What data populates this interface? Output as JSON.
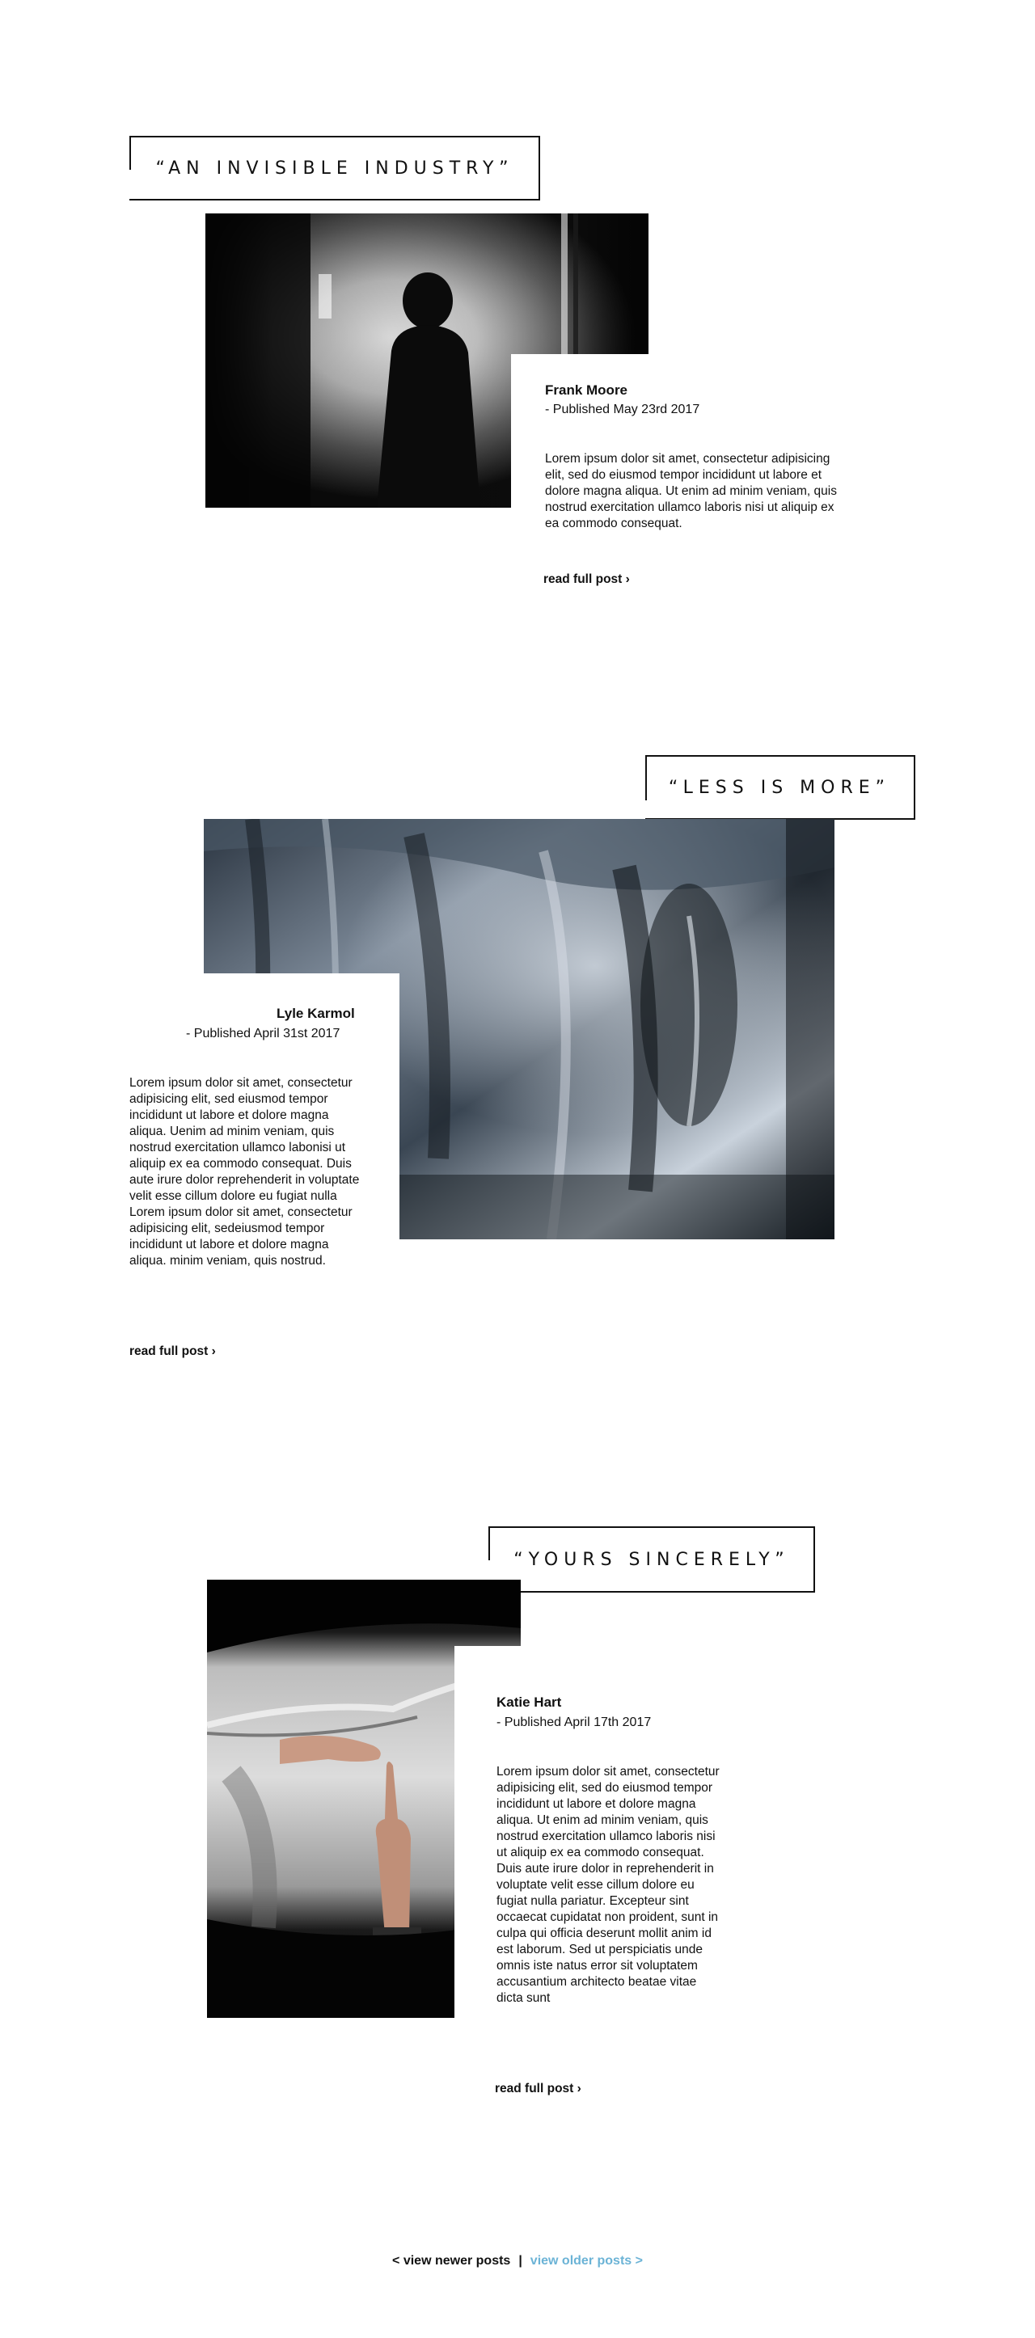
{
  "posts": [
    {
      "title": "“AN INVISIBLE INDUSTRY”",
      "author": "Frank Moore",
      "published": "- Published May 23rd 2017",
      "excerpt": "Lorem ipsum dolor sit amet, consectetur adipisicing elit, sed do eiusmod tempor incididunt ut labore et dolore magna aliqua. Ut enim ad minim veniam, quis nostrud exercitation ullamco laboris nisi ut aliquip ex ea commodo consequat.",
      "read_more": "read full post ›",
      "image": "figure-in-fog-photo"
    },
    {
      "title": "“LESS IS MORE”",
      "author": "Lyle Karmol",
      "published": "- Published April 31st 2017",
      "excerpt": "Lorem ipsum dolor sit amet, consectetur adipisicing elit, sed eiusmod tempor incididunt ut labore et dolore magna aliqua. Uenim ad minim veniam, quis nostrud exercitation ullamco labonisi ut aliquip ex ea commodo consequat. Duis aute irure dolor reprehenderit in voluptate velit esse cillum dolore eu fugiat nulla Lorem ipsum dolor sit amet, consectetur adipisicing elit, sedeiusmod tempor incididunt ut labore et dolore magna aliqua. minim veniam, quis nostrud.",
      "read_more": "read full post ›",
      "image": "metal-sculpture-photo"
    },
    {
      "title": "“YOURS SINCERELY”",
      "author": "Katie Hart",
      "published": "- Published April 17th 2017",
      "excerpt": "Lorem ipsum dolor sit amet, consectetur adipisicing elit, sed do eiusmod tempor incididunt ut labore et dolore magna aliqua. Ut enim ad minim veniam, quis nostrud exercitation ullamco laboris nisi ut aliquip ex ea commodo consequat. Duis aute irure dolor in reprehenderit in voluptate velit esse cillum dolore eu fugiat nulla pariatur. Excepteur sint occaecat cupidatat non proident, sunt in culpa qui officia deserunt mollit anim id est laborum. Sed ut perspiciatis unde omnis iste natus error sit voluptatem accusantium architecto beatae vitae dicta sunt",
      "read_more": "read full post ›",
      "image": "hands-fabric-photo"
    }
  ],
  "pagination": {
    "newer": "< view newer posts",
    "separator": "|",
    "older": "view older posts >"
  },
  "colors": {
    "text": "#111111",
    "link_accent": "#6bb3d6",
    "background": "#ffffff"
  }
}
